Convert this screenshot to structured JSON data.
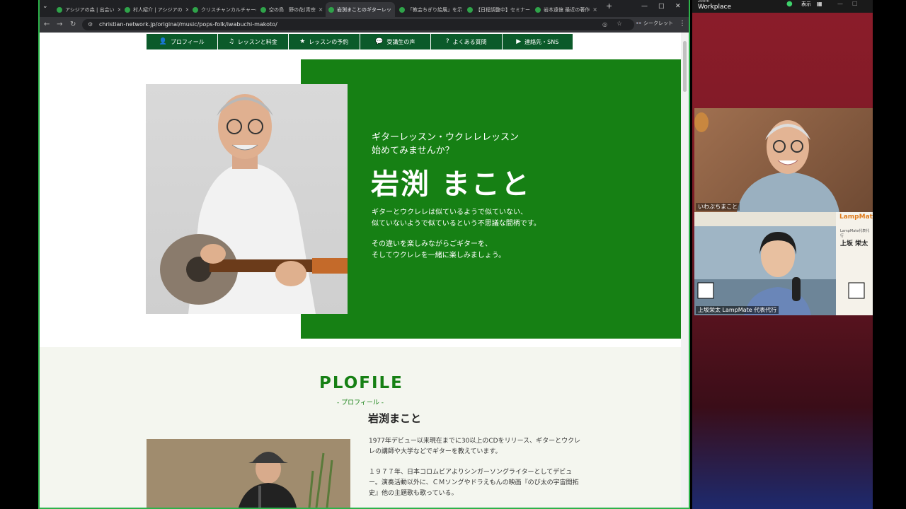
{
  "browser": {
    "tabs": [
      {
        "label": "アシジアの森 | 出会い"
      },
      {
        "label": "村人紹介 | アシジアの"
      },
      {
        "label": "クリスチャンカルチャーの"
      },
      {
        "label": "空の鳥　野の花(青宗"
      },
      {
        "label": "岩渕まことのギターレッ",
        "active": true
      },
      {
        "label": "「教会ちぎり絵展」を示"
      },
      {
        "label": "【日程調整中】セミナー"
      },
      {
        "label": "岩本遠億 最近の著作"
      }
    ],
    "url": "christian-network.jp/original/music/pops-folk/iwabuchi-makoto/",
    "incognito_label": "シークレット"
  },
  "page": {
    "nav": [
      {
        "icon": "person-icon",
        "label": "プロフィール"
      },
      {
        "icon": "music-note-icon",
        "label": "レッスンと料金"
      },
      {
        "icon": "star-icon",
        "label": "レッスンの予約"
      },
      {
        "icon": "speech-bubble-icon",
        "label": "受講生の声"
      },
      {
        "icon": "question-icon",
        "label": "よくある質問"
      },
      {
        "icon": "youtube-icon",
        "label": "連絡先・SNS"
      }
    ],
    "hero": {
      "subtitle_line1": "ギターレッスン・ウクレレレッスン",
      "subtitle_line2": "始めてみませんか？",
      "name": "岩渕 まこと",
      "para1_line1": "ギターとウクレレは似ているようで似ていない、",
      "para1_line2": "似ていないようで似ているという不思議な間柄です。",
      "para2_line1": "その違いを楽しみながらごギターを、",
      "para2_line2": "そしてウクレレを一緒に楽しみましょう。"
    },
    "profile": {
      "heading": "PLOFILE",
      "subheading": "- プロフィール -",
      "name": "岩渕まこと",
      "p1_line1": "1977年デビュー以来現在までに30以上のCDをリリース、ギターとウクレ",
      "p1_line2": "レの講師や大学などでギターを教えています。",
      "p2_line1": "１９７７年、日本コロムビアよりシンガーソングライターとしてデビュ",
      "p2_line2": "ー。演奏活動以外に、ＣＭソングやドラえもんの映画『のび太の宇宙開拓",
      "p2_line3": "史』他の主題歌も歌っている。"
    }
  },
  "zoom": {
    "brand_small": "zoom",
    "brand": "Workplace",
    "view_label": "表示",
    "participants": [
      {
        "name": "いわぶちまこと"
      },
      {
        "name": "上坂栄太 LampMate 代表代行"
      }
    ],
    "card": {
      "logo": "LampMate",
      "role": "LampMate代表代行",
      "name": "上坂 栄太"
    }
  },
  "colors": {
    "hero_green": "#168014",
    "nav_green": "#0b5a2a"
  }
}
